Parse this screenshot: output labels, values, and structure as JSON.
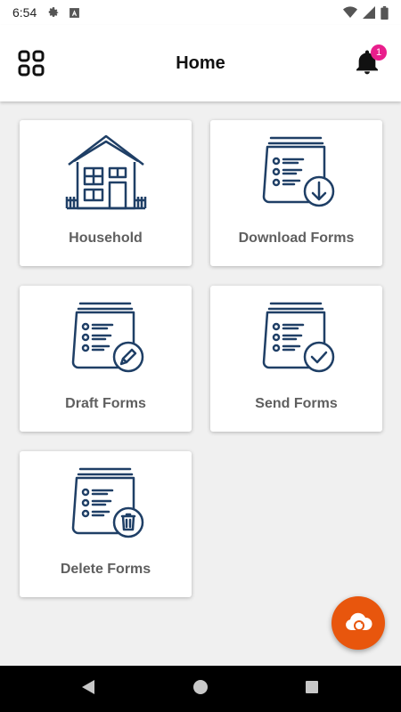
{
  "status_bar": {
    "time": "6:54",
    "left_icons": [
      "settings-icon",
      "a-box-icon"
    ],
    "right_icons": [
      "wifi-icon",
      "signal-icon",
      "battery-icon"
    ]
  },
  "app_bar": {
    "title": "Home",
    "menu_icon": "grid-menu-icon",
    "notification_icon": "bell-icon",
    "notification_count": "1"
  },
  "cards": [
    {
      "id": "household",
      "label": "Household",
      "icon": "house-icon"
    },
    {
      "id": "download",
      "label": "Download Forms",
      "icon": "form-download-icon"
    },
    {
      "id": "draft",
      "label": "Draft Forms",
      "icon": "form-edit-icon"
    },
    {
      "id": "send",
      "label": "Send Forms",
      "icon": "form-check-icon"
    },
    {
      "id": "delete",
      "label": "Delete Forms",
      "icon": "form-delete-icon"
    }
  ],
  "fab": {
    "icon": "cloud-sync-icon"
  },
  "nav": {
    "back": "back-icon",
    "home": "home-icon",
    "recents": "recents-icon"
  },
  "colors": {
    "accent": "#e8560d",
    "icon_navy": "#1f3f66",
    "badge": "#e91e8c",
    "label_grey": "#5f5f5f"
  }
}
